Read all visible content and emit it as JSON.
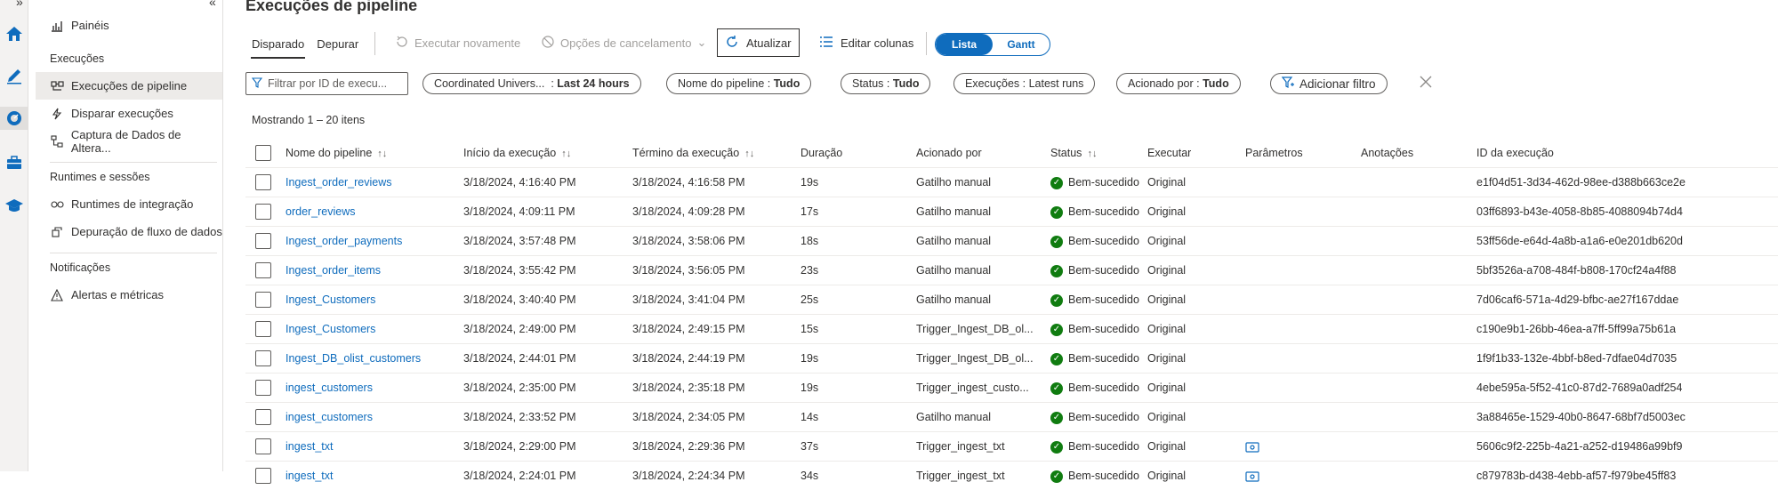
{
  "page": {
    "title": "Execuções de pipeline"
  },
  "sidebar": {
    "top_item": "Painéis",
    "sections": [
      {
        "label": "Execuções",
        "items": [
          "Execuções de pipeline",
          "Disparar execuções",
          "Captura de Dados de Altera..."
        ]
      },
      {
        "label": "Runtimes e sessões",
        "items": [
          "Runtimes de integração",
          "Depuração de fluxo de dados"
        ]
      },
      {
        "label": "Notificações",
        "items": [
          "Alertas e métricas"
        ]
      }
    ]
  },
  "tabs": [
    "Disparado",
    "Depurar"
  ],
  "toolbar": {
    "rerun": "Executar novamente",
    "cancel_options": "Opções de cancelamento",
    "refresh": "Atualizar",
    "edit_columns": "Editar colunas",
    "view_list": "Lista",
    "view_gantt": "Gantt"
  },
  "filters": {
    "search_placeholder": "Filtrar por ID de execu...",
    "time_zone": "Coordinated Univers...",
    "time_range": "Last 24 hours",
    "pipeline_name_label": "Nome do pipeline",
    "pipeline_name_value": "Tudo",
    "status_label": "Status",
    "status_value": "Tudo",
    "runs_label": "Execuções",
    "runs_value": "Latest runs",
    "triggered_by_label": "Acionado por",
    "triggered_by_value": "Tudo",
    "add_filter": "Adicionar filtro"
  },
  "count_label": "Mostrando 1 – 20 itens",
  "columns": [
    "Nome do pipeline",
    "Início da execução",
    "Término da execução",
    "Duração",
    "Acionado por",
    "Status",
    "Executar",
    "Parâmetros",
    "Anotações",
    "ID da execução"
  ],
  "rows": [
    {
      "name": "Ingest_order_reviews",
      "start": "3/18/2024, 4:16:40 PM",
      "end": "3/18/2024, 4:16:58 PM",
      "duration": "19s",
      "triggered_by": "Gatilho manual",
      "status": "Bem-sucedido",
      "run": "Original",
      "params": false,
      "run_id": "e1f04d51-3d34-462d-98ee-d388b663ce2e"
    },
    {
      "name": "order_reviews",
      "start": "3/18/2024, 4:09:11 PM",
      "end": "3/18/2024, 4:09:28 PM",
      "duration": "17s",
      "triggered_by": "Gatilho manual",
      "status": "Bem-sucedido",
      "run": "Original",
      "params": false,
      "run_id": "03ff6893-b43e-4058-8b85-4088094b74d4"
    },
    {
      "name": "Ingest_order_payments",
      "start": "3/18/2024, 3:57:48 PM",
      "end": "3/18/2024, 3:58:06 PM",
      "duration": "18s",
      "triggered_by": "Gatilho manual",
      "status": "Bem-sucedido",
      "run": "Original",
      "params": false,
      "run_id": "53ff56de-e64d-4a8b-a1a6-e0e201db620d"
    },
    {
      "name": "Ingest_order_items",
      "start": "3/18/2024, 3:55:42 PM",
      "end": "3/18/2024, 3:56:05 PM",
      "duration": "23s",
      "triggered_by": "Gatilho manual",
      "status": "Bem-sucedido",
      "run": "Original",
      "params": false,
      "run_id": "5bf3526a-a708-484f-b808-170cf24a4f88"
    },
    {
      "name": "Ingest_Customers",
      "start": "3/18/2024, 3:40:40 PM",
      "end": "3/18/2024, 3:41:04 PM",
      "duration": "25s",
      "triggered_by": "Gatilho manual",
      "status": "Bem-sucedido",
      "run": "Original",
      "params": false,
      "run_id": "7d06caf6-571a-4d29-bfbc-ae27f167ddae"
    },
    {
      "name": "Ingest_Customers",
      "start": "3/18/2024, 2:49:00 PM",
      "end": "3/18/2024, 2:49:15 PM",
      "duration": "15s",
      "triggered_by": "Trigger_Ingest_DB_ol...",
      "status": "Bem-sucedido",
      "run": "Original",
      "params": false,
      "run_id": "c190e9b1-26bb-46ea-a7ff-5ff99a75b61a"
    },
    {
      "name": "Ingest_DB_olist_customers",
      "start": "3/18/2024, 2:44:01 PM",
      "end": "3/18/2024, 2:44:19 PM",
      "duration": "19s",
      "triggered_by": "Trigger_Ingest_DB_ol...",
      "status": "Bem-sucedido",
      "run": "Original",
      "params": false,
      "run_id": "1f9f1b33-132e-4bbf-b8ed-7dfae04d7035"
    },
    {
      "name": "ingest_customers",
      "start": "3/18/2024, 2:35:00 PM",
      "end": "3/18/2024, 2:35:18 PM",
      "duration": "19s",
      "triggered_by": "Trigger_ingest_custo...",
      "status": "Bem-sucedido",
      "run": "Original",
      "params": false,
      "run_id": "4ebe595a-5f52-41c0-87d2-7689a0adf254"
    },
    {
      "name": "ingest_customers",
      "start": "3/18/2024, 2:33:52 PM",
      "end": "3/18/2024, 2:34:05 PM",
      "duration": "14s",
      "triggered_by": "Gatilho manual",
      "status": "Bem-sucedido",
      "run": "Original",
      "params": false,
      "run_id": "3a88465e-1529-40b0-8647-68bf7d5003ec"
    },
    {
      "name": "ingest_txt",
      "start": "3/18/2024, 2:29:00 PM",
      "end": "3/18/2024, 2:29:36 PM",
      "duration": "37s",
      "triggered_by": "Trigger_ingest_txt",
      "status": "Bem-sucedido",
      "run": "Original",
      "params": true,
      "run_id": "5606c9f2-225b-4a21-a252-d19486a99bf9"
    },
    {
      "name": "ingest_txt",
      "start": "3/18/2024, 2:24:01 PM",
      "end": "3/18/2024, 2:24:34 PM",
      "duration": "34s",
      "triggered_by": "Trigger_ingest_txt",
      "status": "Bem-sucedido",
      "run": "Original",
      "params": true,
      "run_id": "c879783b-d438-4ebb-af57-f979be45ff83"
    }
  ],
  "colors": {
    "accent": "#0f6cbd",
    "success": "#107c10"
  }
}
